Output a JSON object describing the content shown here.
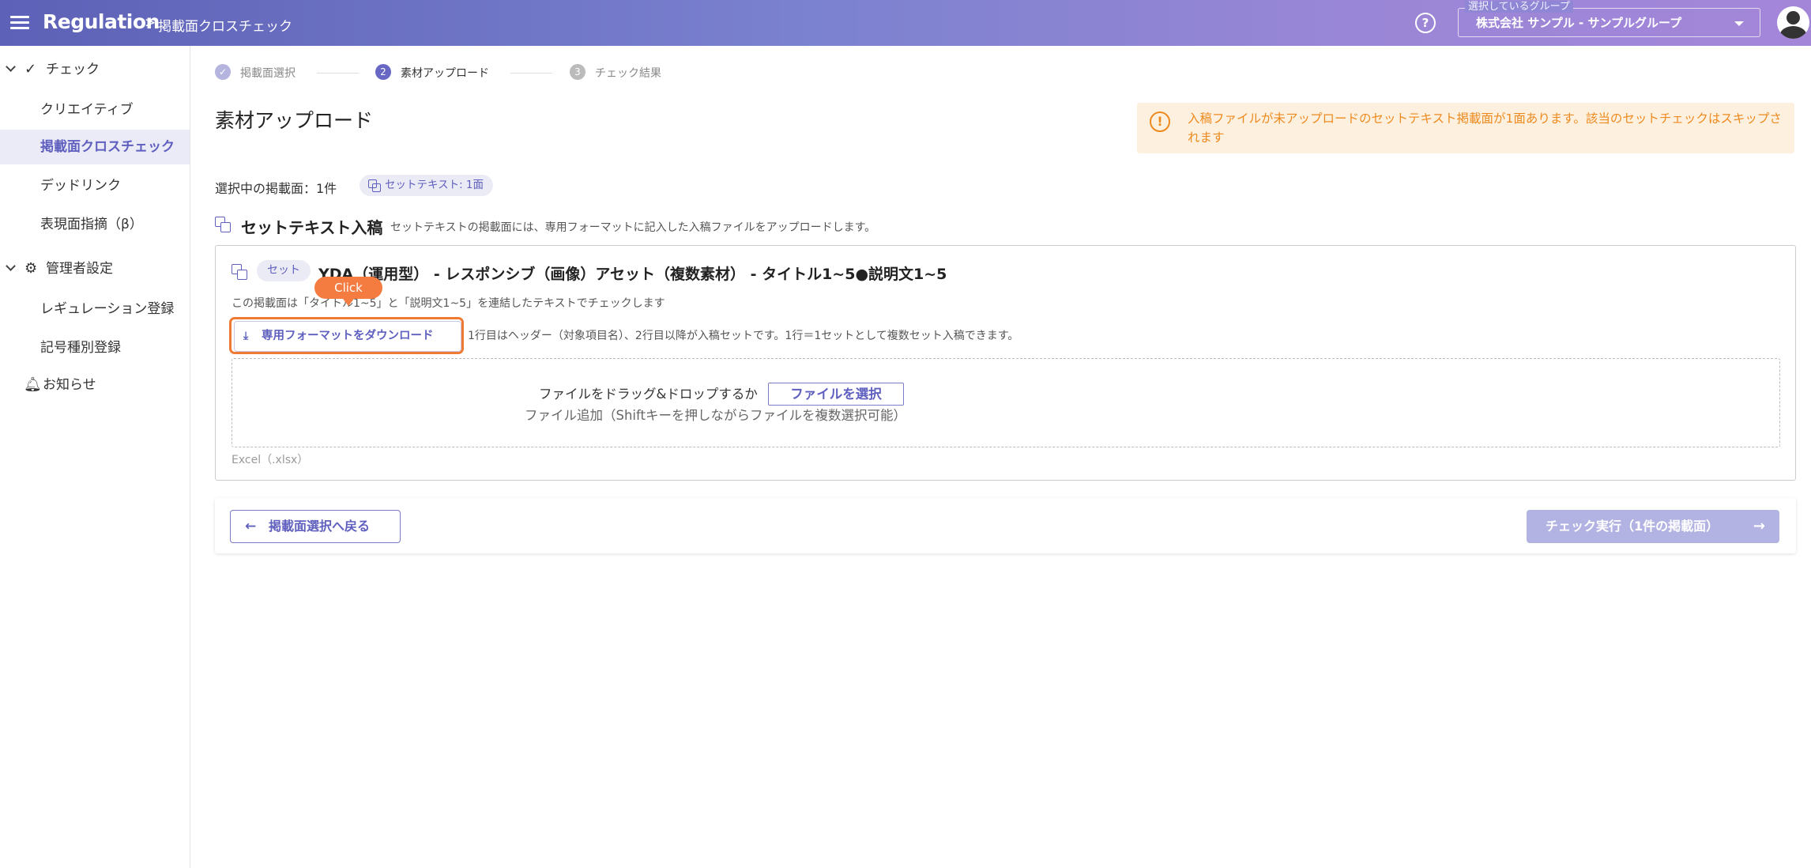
{
  "header": {
    "app_title": "Regulation",
    "breadcrumb_sep": ">",
    "breadcrumb_page": "掲載面クロスチェック",
    "help_icon": "?",
    "group_legend": "選択しているグループ",
    "group_value": "株式会社 サンプル - サンプルグループ"
  },
  "sidebar": {
    "items": [
      {
        "label": "チェック",
        "icon": "check-icon",
        "kind": "parent"
      },
      {
        "label": "クリエイティブ",
        "kind": "child"
      },
      {
        "label": "掲載面クロスチェック",
        "kind": "child",
        "active": true
      },
      {
        "label": "デッドリンク",
        "kind": "child"
      },
      {
        "label": "表現面指摘（β）",
        "kind": "child"
      },
      {
        "label": "管理者設定",
        "icon": "admin-settings-icon",
        "kind": "parent"
      },
      {
        "label": "レギュレーション登録",
        "kind": "child"
      },
      {
        "label": "記号種別登録",
        "kind": "child"
      },
      {
        "label": "お知らせ",
        "icon": "bell-icon",
        "kind": "parent"
      }
    ]
  },
  "stepper": {
    "steps": [
      {
        "num": "✓",
        "label": "掲載面選択",
        "state": "done"
      },
      {
        "num": "2",
        "label": "素材アップロード",
        "state": "current"
      },
      {
        "num": "3",
        "label": "チェック結果",
        "state": "todo"
      }
    ]
  },
  "main": {
    "title": "素材アップロード",
    "warning": "入稿ファイルが未アップロードのセットテキスト掲載面が1面あります。該当のセットチェックはスキップされます",
    "selected_label": "選択中の掲載面：1件",
    "selected_chip": "セットテキスト: 1面",
    "section_title": "セットテキスト入稿",
    "section_desc": "セットテキストの掲載面には、専用フォーマットに記入した入稿ファイルをアップロードします。"
  },
  "card": {
    "chip": "セット",
    "title": "YDA（運用型） - レスポンシブ（画像）アセット（複数素材） - タイトル1~5●説明文1~5",
    "note": "この掲載面は「タイトル1~5」と「説明文1~5」を連結したテキストでチェックします",
    "download_button": "専用フォーマットをダウンロード",
    "download_note": "1行目はヘッダー（対象項目名）、2行目以降が入稿セットです。1行＝1セットとして複数セット入稿できます。",
    "click_badge": "Click",
    "dropzone_text": "ファイルをドラッグ&ドロップするか",
    "dropzone_button": "ファイルを選択",
    "dropzone_sub": "ファイル追加（Shiftキーを押しながらファイルを複数選択可能）",
    "file_types": "Excel（.xlsx）"
  },
  "footer": {
    "back_button": "掲載面選択へ戻る",
    "run_button": "チェック実行（1件の掲載面）"
  },
  "colors": {
    "accent": "#5f5fbf",
    "warning": "#ed8a1f",
    "highlight": "#f07a34"
  }
}
